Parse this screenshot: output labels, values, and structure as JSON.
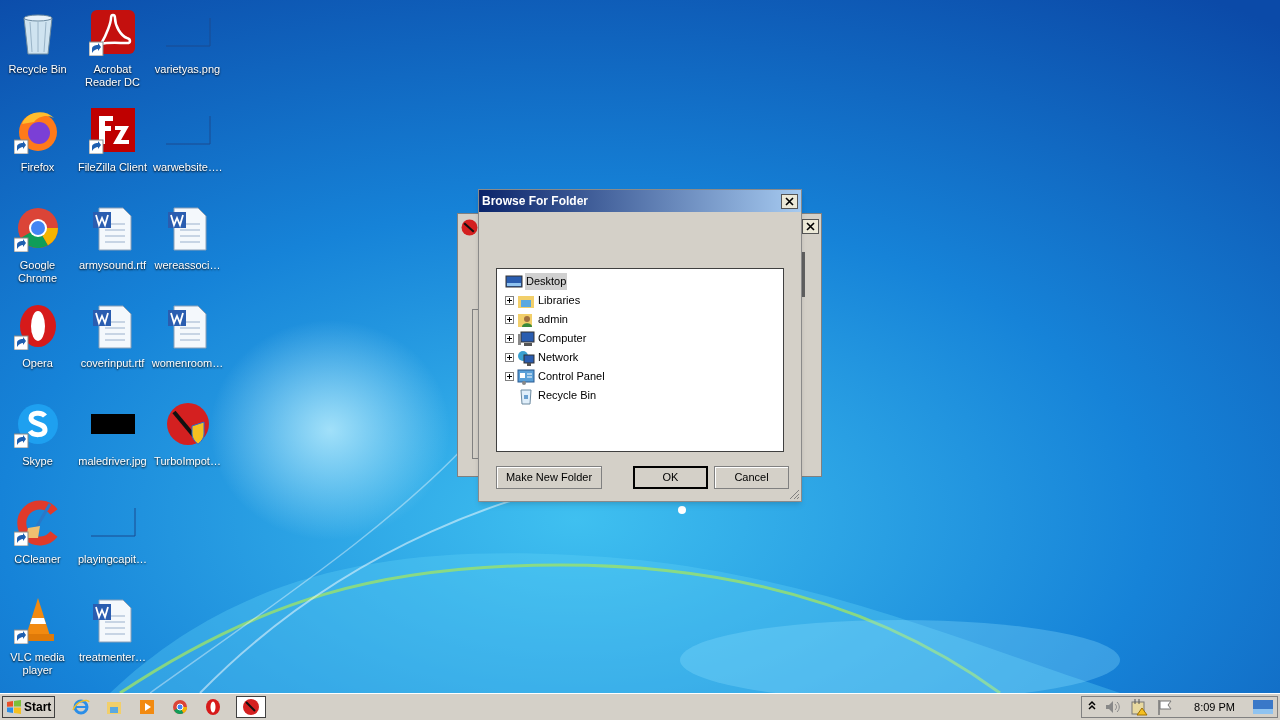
{
  "desktop_icons": [
    {
      "label": "Recycle Bin",
      "kind": "recycle",
      "shortcut": false
    },
    {
      "label": "Firefox",
      "kind": "firefox",
      "shortcut": true
    },
    {
      "label": "Google Chrome",
      "kind": "chrome",
      "shortcut": true
    },
    {
      "label": "Opera",
      "kind": "opera",
      "shortcut": true
    },
    {
      "label": "Skype",
      "kind": "skype",
      "shortcut": true
    },
    {
      "label": "CCleaner",
      "kind": "ccleaner",
      "shortcut": true
    },
    {
      "label": "VLC media player",
      "kind": "vlc",
      "shortcut": true
    },
    {
      "label": "Acrobat Reader DC",
      "kind": "acrobat",
      "shortcut": true
    },
    {
      "label": "FileZilla Client",
      "kind": "filezilla",
      "shortcut": true
    },
    {
      "label": "armysound.rtf",
      "kind": "word",
      "shortcut": false
    },
    {
      "label": "coverinput.rtf",
      "kind": "word",
      "shortcut": false
    },
    {
      "label": "maledriver.jpg",
      "kind": "black-image",
      "shortcut": false
    },
    {
      "label": "playingcapit…",
      "kind": "blank",
      "shortcut": false
    },
    {
      "label": "treatmenter…",
      "kind": "word",
      "shortcut": false
    },
    {
      "label": "varietyas.png",
      "kind": "blank",
      "shortcut": false
    },
    {
      "label": "warwebsite….",
      "kind": "blank",
      "shortcut": false
    },
    {
      "label": "wereassoci…",
      "kind": "word",
      "shortcut": false
    },
    {
      "label": "womenroom…",
      "kind": "word",
      "shortcut": false
    },
    {
      "label": "TurboImpot…",
      "kind": "turbo",
      "shortcut": false
    }
  ],
  "dialog": {
    "title": "Browse For Folder",
    "tree": {
      "label": "Desktop",
      "selected": true,
      "children": [
        {
          "label": "Libraries",
          "kind": "libraries",
          "expandable": true,
          "selected": false
        },
        {
          "label": "admin",
          "kind": "user",
          "expandable": true,
          "selected": false
        },
        {
          "label": "Computer",
          "kind": "computer",
          "expandable": true,
          "selected": false
        },
        {
          "label": "Network",
          "kind": "network",
          "expandable": true,
          "selected": false
        },
        {
          "label": "Control Panel",
          "kind": "control-panel",
          "expandable": true,
          "selected": false
        },
        {
          "label": "Recycle Bin",
          "kind": "recycle",
          "expandable": false,
          "selected": false
        }
      ]
    },
    "buttons": [
      {
        "label": "Make New Folder",
        "default": false
      },
      {
        "label": "OK",
        "default": true
      },
      {
        "label": "Cancel",
        "default": false
      }
    ]
  },
  "taskbar": {
    "start_label": "Start",
    "apps": [
      {
        "kind": "ie",
        "active": false
      },
      {
        "kind": "explorer",
        "active": false
      },
      {
        "kind": "media",
        "active": false
      },
      {
        "kind": "chrome",
        "active": false
      },
      {
        "kind": "opera",
        "active": false
      },
      {
        "kind": "turbo",
        "active": true
      }
    ],
    "tray": [
      {
        "kind": "chevron"
      },
      {
        "kind": "speaker"
      },
      {
        "kind": "network-warning"
      },
      {
        "kind": "flag"
      }
    ],
    "clock": "8:09 PM"
  }
}
